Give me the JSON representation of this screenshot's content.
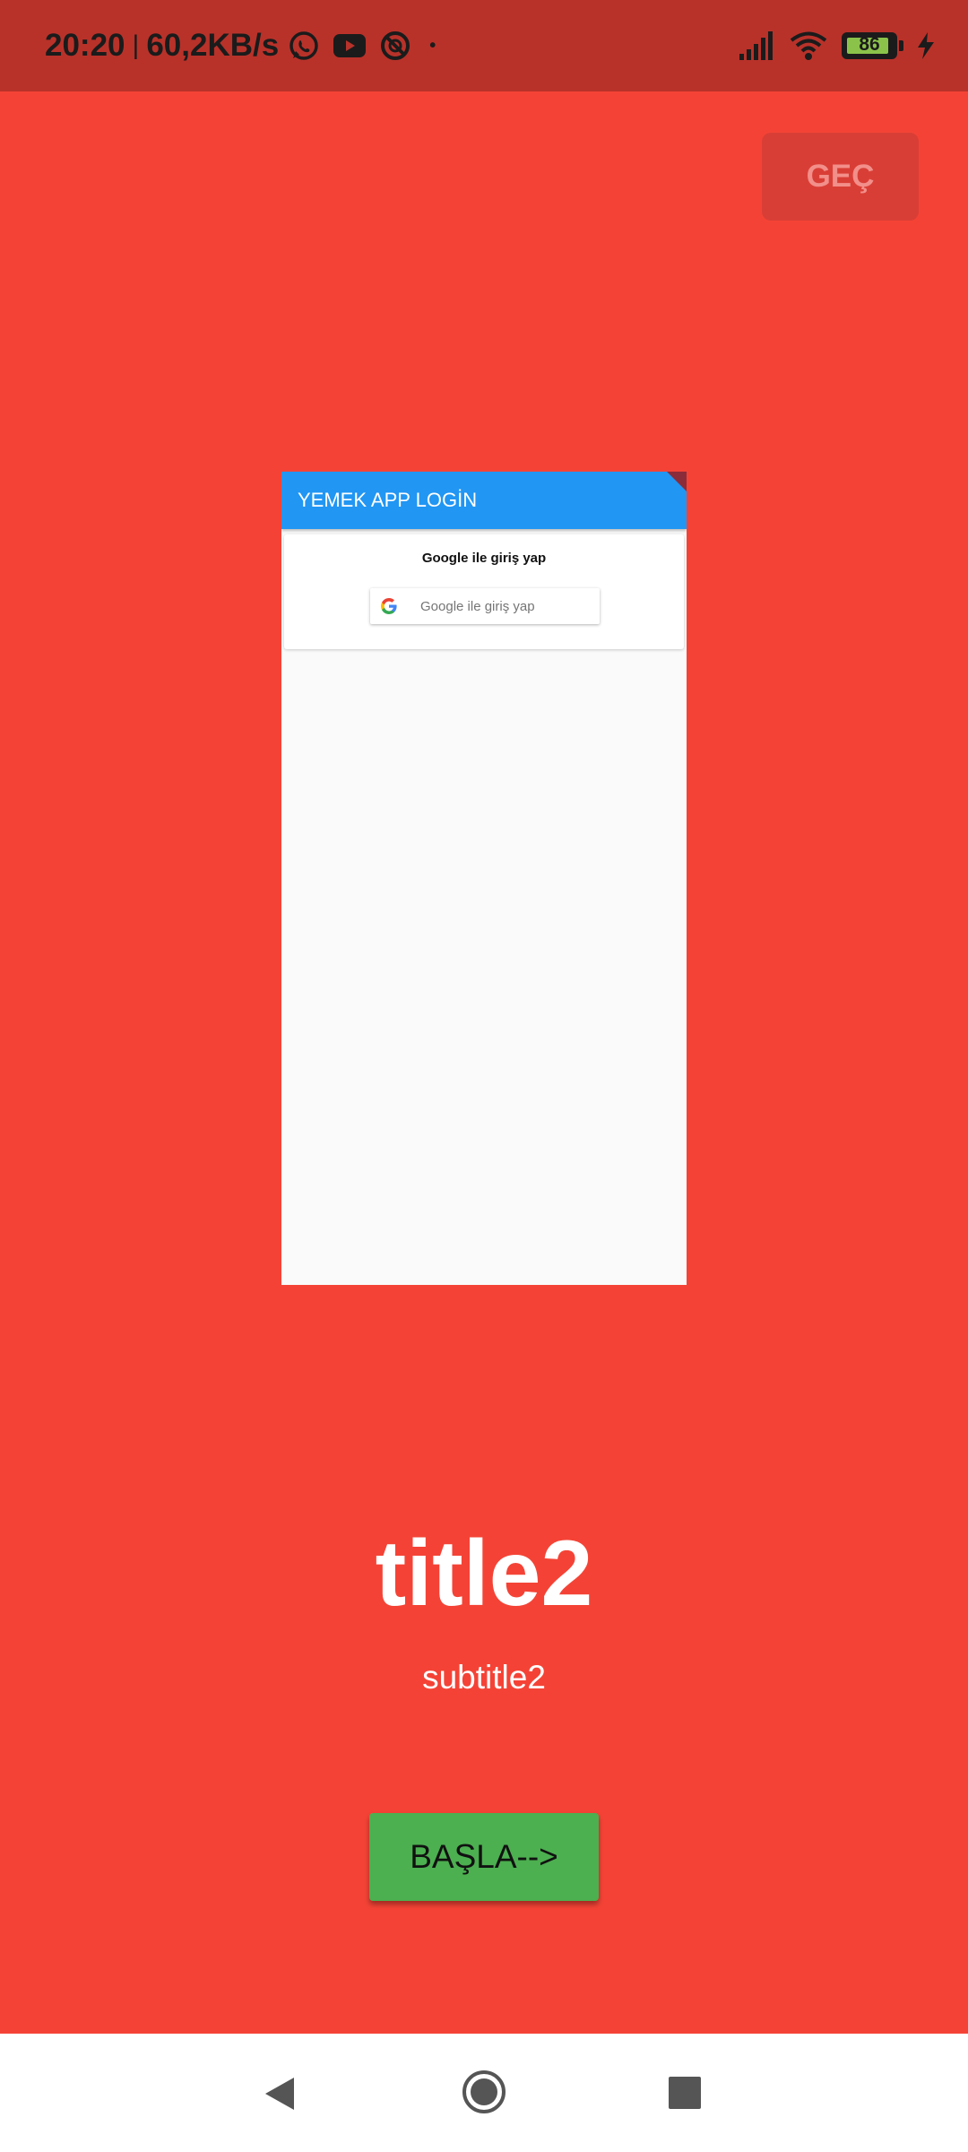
{
  "status_bar": {
    "time": "20:20",
    "separator": "|",
    "network_speed": "60,2KB/s",
    "dot": "•",
    "battery_level": "86",
    "icons": [
      "whatsapp-icon",
      "youtube-icon",
      "blocked-app-icon",
      "signal-icon",
      "wifi-icon",
      "battery-icon",
      "charging-icon"
    ]
  },
  "skip_button": {
    "label": "GEÇ"
  },
  "preview": {
    "appbar_title": "YEMEK APP LOGİN",
    "card_title": "Google ile giriş yap",
    "google_button_label": "Google ile giriş yap"
  },
  "onboarding": {
    "title": "title2",
    "subtitle": "subtitle2"
  },
  "start_button": {
    "label": "BAŞLA-->"
  },
  "colors": {
    "background": "#F44336",
    "status_bar": "#B8322A",
    "appbar": "#2196F3",
    "start_button": "#4CAF50",
    "skip_button": "#D93E36"
  },
  "nav_bar": {
    "icons": [
      "back-icon",
      "home-icon",
      "recents-icon"
    ]
  }
}
